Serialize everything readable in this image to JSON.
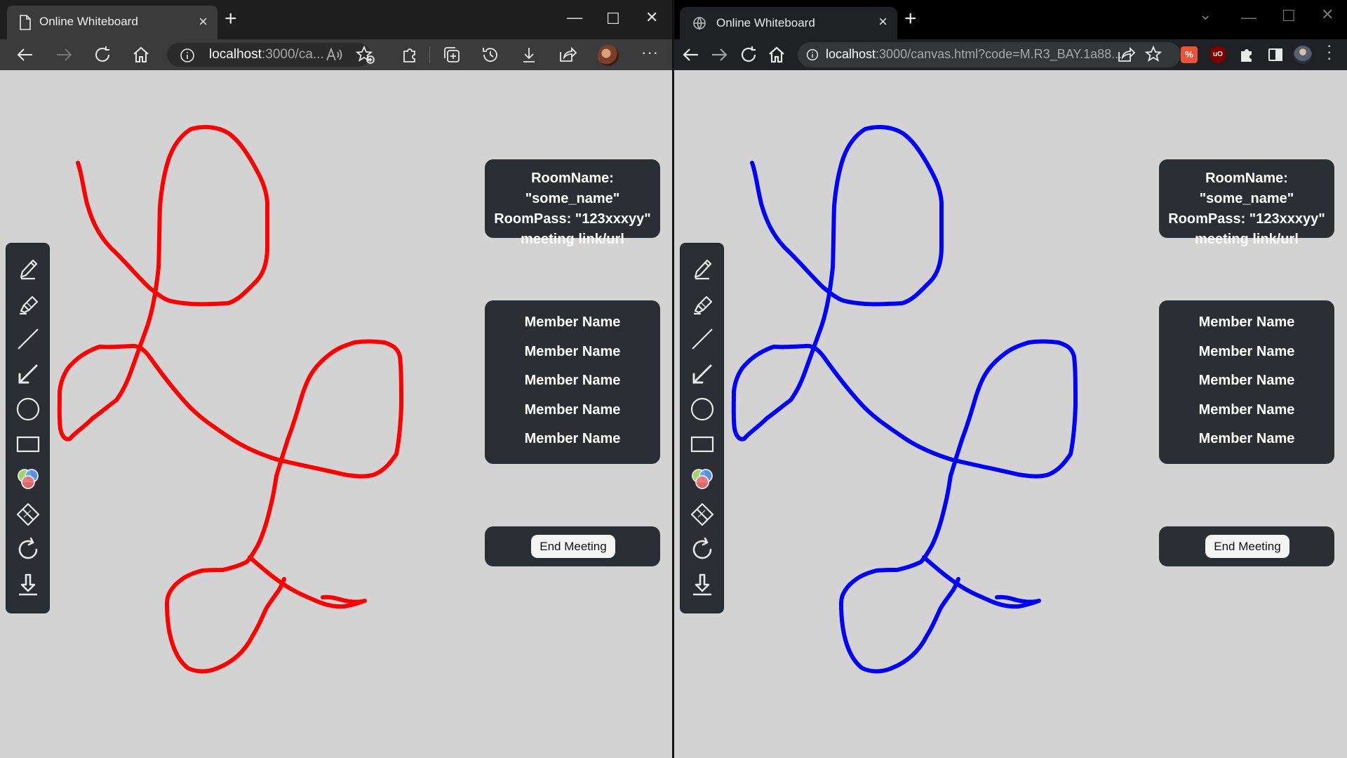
{
  "left_window": {
    "browser": "Edge",
    "tab_title": "Online Whiteboard",
    "address": {
      "host": "localhost",
      "rest": ":3000/ca..."
    },
    "stroke_color": "#ff0000"
  },
  "right_window": {
    "browser": "Chrome",
    "tab_title": "Online Whiteboard",
    "address": {
      "host": "localhost",
      "rest": ":3000/canvas.html?code=M.R3_BAY.1a88..."
    },
    "stroke_color": "#0000ff"
  },
  "room_info": {
    "line1": "RoomName: \"some_name\"",
    "line2": "RoomPass: \"123xxxyy\"",
    "line3": "meeting link/url"
  },
  "members": [
    "Member Name",
    "Member Name",
    "Member Name",
    "Member Name",
    "Member Name"
  ],
  "end_meeting_label": "End Meeting",
  "tools": [
    {
      "name": "pencil-icon"
    },
    {
      "name": "highlighter-icon"
    },
    {
      "name": "line-icon"
    },
    {
      "name": "arrow-icon"
    },
    {
      "name": "circle-icon"
    },
    {
      "name": "rectangle-icon"
    },
    {
      "name": "color-picker-icon"
    },
    {
      "name": "eraser-icon"
    },
    {
      "name": "refresh-icon"
    },
    {
      "name": "download-icon"
    }
  ],
  "colors": {
    "canvas_bg": "#d3d3d3",
    "panel_bg": "#2b2f33"
  }
}
